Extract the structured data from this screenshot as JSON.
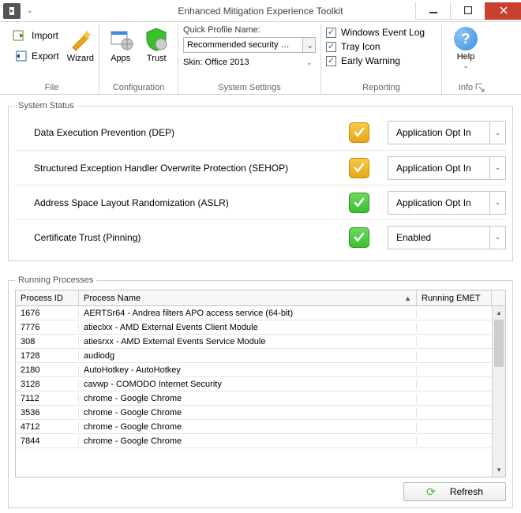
{
  "window": {
    "title": "Enhanced Mitigation Experience Toolkit"
  },
  "ribbon": {
    "file": {
      "import": "Import",
      "export": "Export",
      "label": "File"
    },
    "config": {
      "wizard": "Wizard",
      "apps": "Apps",
      "trust": "Trust",
      "label": "Configuration"
    },
    "settings": {
      "profile_label": "Quick Profile Name:",
      "profile_value": "Recommended security …",
      "skin_label": "Skin:",
      "skin_value": "Office 2013",
      "label": "System Settings"
    },
    "reporting": {
      "event_log": "Windows Event Log",
      "tray_icon": "Tray Icon",
      "early_warning": "Early Warning",
      "label": "Reporting"
    },
    "info": {
      "help": "Help",
      "label": "Info"
    }
  },
  "status": {
    "legend": "System Status",
    "rows": [
      {
        "name": "Data Execution Prevention (DEP)",
        "level": "warn",
        "value": "Application Opt In"
      },
      {
        "name": "Structured Exception Handler Overwrite Protection (SEHOP)",
        "level": "warn",
        "value": "Application Opt In"
      },
      {
        "name": "Address Space Layout Randomization (ASLR)",
        "level": "ok",
        "value": "Application Opt In"
      },
      {
        "name": "Certificate Trust (Pinning)",
        "level": "ok",
        "value": "Enabled"
      }
    ]
  },
  "processes": {
    "legend": "Running Processes",
    "columns": {
      "pid": "Process ID",
      "name": "Process Name",
      "emet": "Running EMET"
    },
    "rows": [
      {
        "pid": "1676",
        "name": "AERTSr64 - Andrea filters APO access service (64-bit)"
      },
      {
        "pid": "7776",
        "name": "atieclxx - AMD External Events Client Module"
      },
      {
        "pid": "308",
        "name": "atiesrxx - AMD External Events Service Module"
      },
      {
        "pid": "1728",
        "name": "audiodg"
      },
      {
        "pid": "2180",
        "name": "AutoHotkey - AutoHotkey"
      },
      {
        "pid": "3128",
        "name": "cavwp - COMODO Internet Security"
      },
      {
        "pid": "7112",
        "name": "chrome - Google Chrome"
      },
      {
        "pid": "3536",
        "name": "chrome - Google Chrome"
      },
      {
        "pid": "4712",
        "name": "chrome - Google Chrome"
      },
      {
        "pid": "7844",
        "name": "chrome - Google Chrome"
      }
    ],
    "refresh": "Refresh"
  }
}
